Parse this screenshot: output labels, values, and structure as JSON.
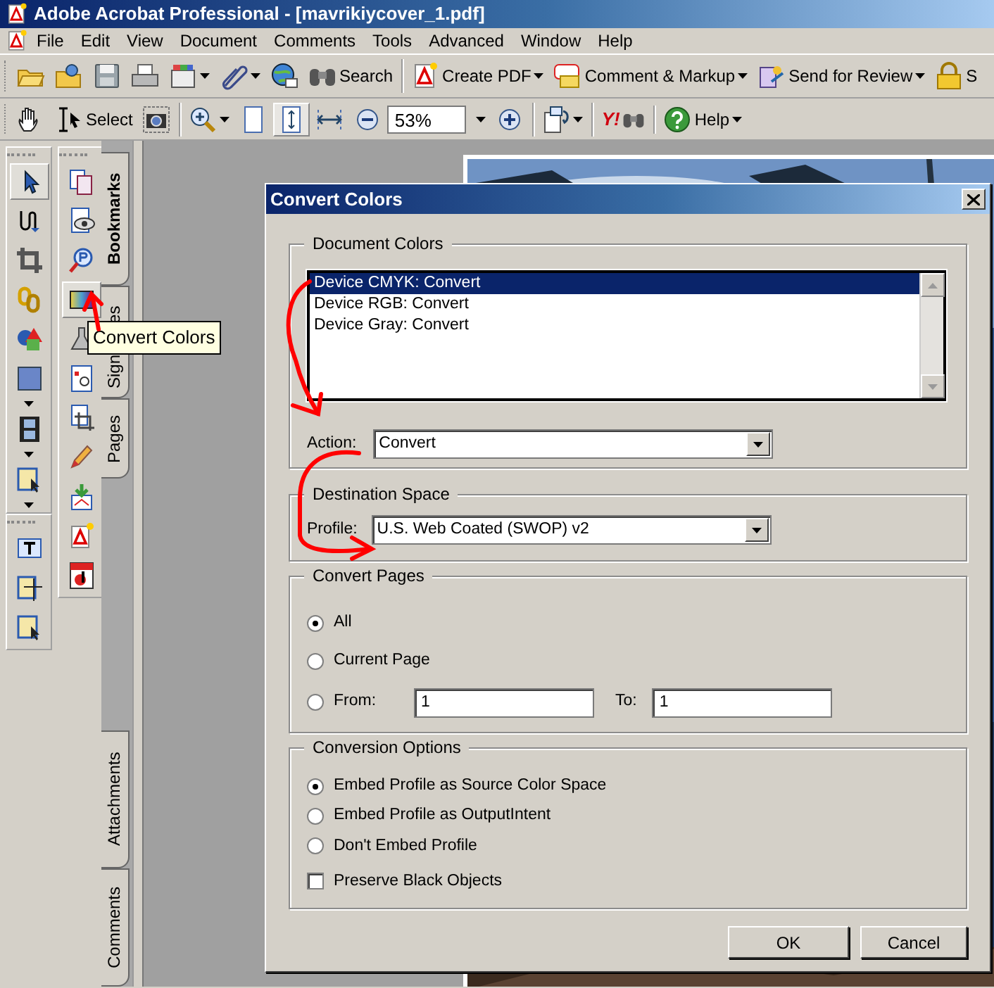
{
  "window": {
    "title": "Adobe Acrobat Professional - [mavrikiycover_1.pdf]"
  },
  "menu": [
    "File",
    "Edit",
    "View",
    "Document",
    "Comments",
    "Tools",
    "Advanced",
    "Window",
    "Help"
  ],
  "toolbar_1": [
    [
      {
        "has_menu": false
      },
      {
        "has_menu": false
      },
      {
        "has_menu": false
      },
      {
        "has_menu": false
      },
      {
        "has_menu": true
      },
      {
        "has_menu": true
      },
      {
        "has_menu": false
      },
      {
        "label": "Search",
        "has_menu": false
      }
    ],
    [
      {
        "label": "Create PDF",
        "has_menu": true
      },
      {
        "label": "Comment & Markup",
        "has_menu": true
      },
      {
        "label": "Send for Review",
        "has_menu": true
      },
      {
        "label": "S",
        "has_menu": false
      }
    ]
  ],
  "toolbar_2": [
    [
      {
        "kind": "button",
        "pressed": false,
        "has_menu": false
      },
      {
        "kind": "button",
        "label": "Select",
        "pressed": false,
        "has_menu": false
      },
      {
        "kind": "button",
        "pressed": false,
        "has_menu": false
      }
    ],
    [
      {
        "kind": "button",
        "pressed": false,
        "has_menu": true
      },
      {
        "kind": "button",
        "pressed": false,
        "has_menu": false
      },
      {
        "kind": "button",
        "pressed": true,
        "has_menu": false
      },
      {
        "kind": "button",
        "pressed": false,
        "has_menu": false
      },
      {
        "kind": "button",
        "pressed": false,
        "has_menu": false
      },
      {
        "kind": "field",
        "value": "53%",
        "has_menu": true
      },
      {
        "kind": "button",
        "pressed": false,
        "has_menu": false
      }
    ],
    [
      {
        "kind": "button",
        "pressed": false,
        "has_menu": true
      }
    ],
    [
      {
        "kind": "logo",
        "label": "Y!",
        "pressed": false,
        "has_menu": false
      }
    ],
    [
      {
        "kind": "button",
        "label": "Help",
        "pressed": false,
        "has_menu": true
      }
    ]
  ],
  "tools_column_1": [
    {
      "pressed": true,
      "has_menu": false
    },
    {
      "pressed": false,
      "has_menu": false
    },
    {
      "pressed": false,
      "has_menu": false
    },
    {
      "pressed": false,
      "has_menu": false
    },
    {
      "pressed": false,
      "has_menu": false
    },
    {
      "pressed": false,
      "has_menu": true
    },
    {
      "pressed": false,
      "has_menu": true
    },
    {
      "pressed": false,
      "has_menu": true
    }
  ],
  "tools_column_1_lower": [
    {
      "pressed": false,
      "has_menu": false
    },
    {
      "pressed": false,
      "has_menu": false
    },
    {
      "pressed": false,
      "has_menu": false
    }
  ],
  "tools_column_2": [
    {
      "pressed": false
    },
    {
      "pressed": false
    },
    {
      "pressed": false
    },
    {
      "pressed": true
    },
    {
      "pressed": false
    },
    {
      "pressed": false
    },
    {
      "pressed": false
    },
    {
      "pressed": false
    },
    {
      "pressed": false
    },
    {
      "pressed": false
    },
    {
      "pressed": false
    }
  ],
  "tooltip": {
    "text": "Convert Colors"
  },
  "nav_tabs_top": [
    {
      "label": "Bookmarks",
      "selected": true
    },
    {
      "label": "Sign",
      "label_end": "es",
      "selected": false
    },
    {
      "label": "Pages",
      "selected": false
    }
  ],
  "nav_tabs_bottom": [
    {
      "label": "Attachments",
      "selected": false
    },
    {
      "label": "Comments",
      "selected": false
    }
  ],
  "dialog": {
    "title": "Convert Colors",
    "document_colors": {
      "legend": "Document Colors",
      "items": [
        {
          "text": "Device CMYK: Convert",
          "selected": true
        },
        {
          "text": "Device RGB: Convert",
          "selected": false
        },
        {
          "text": "Device Gray: Convert",
          "selected": false
        }
      ],
      "action_label": "Action:",
      "action_value": "Convert"
    },
    "destination_space": {
      "legend": "Destination Space",
      "profile_label": "Profile:",
      "profile_value": "U.S. Web Coated (SWOP) v2"
    },
    "convert_pages": {
      "legend": "Convert Pages",
      "options": [
        {
          "label": "All",
          "selected": true
        },
        {
          "label": "Current Page",
          "selected": false
        },
        {
          "label": "From:",
          "selected": false
        }
      ],
      "from_value": "1",
      "to_label": "To:",
      "to_value": "1"
    },
    "conversion_options": {
      "legend": "Conversion Options",
      "options": [
        {
          "label": "Embed Profile as Source Color Space",
          "selected": true
        },
        {
          "label": "Embed Profile as OutputIntent",
          "selected": false
        },
        {
          "label": "Don't Embed Profile",
          "selected": false
        }
      ],
      "preserve_black": {
        "label": "Preserve Black Objects",
        "checked": false
      }
    },
    "buttons": [
      "OK",
      "Cancel"
    ]
  }
}
